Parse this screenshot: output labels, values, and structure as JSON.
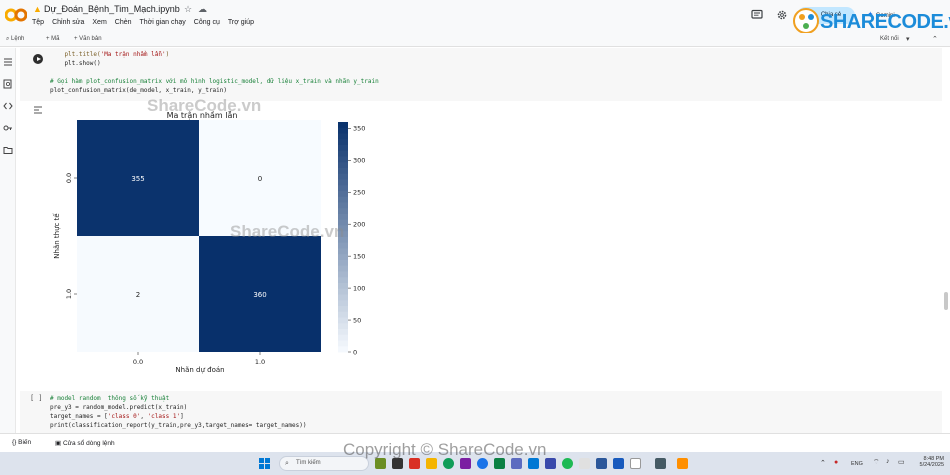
{
  "header": {
    "notebook_title": "Dự_Đoán_Bệnh_Tim_Mạch.ipynb",
    "menu": [
      "Tệp",
      "Chỉnh sửa",
      "Xem",
      "Chèn",
      "Thời gian chạy",
      "Công cụ",
      "Trợ giúp"
    ],
    "share_label": "Chia sẻ",
    "gemini_label": "Gemini"
  },
  "toolbar": {
    "commands_label": "Lệnh",
    "add_code_label": "+ Mã",
    "add_text_label": "+ Văn bản",
    "connect_label": "Kết nối"
  },
  "cell1": {
    "lines": [
      "    plt.title('Ma trận nhầm lẫn')",
      "    plt.show()",
      "",
      "# Gọi hàm plot_confusion_matrix với mô hình logistic_model, dữ liệu x_train và nhãn y_train",
      "plot_confusion_matrix(de_model, x_train, y_train)"
    ]
  },
  "chart_data": {
    "type": "heatmap",
    "title": "Ma trận nhầm lẫn",
    "xlabel": "Nhãn dự đoán",
    "ylabel": "Nhãn thực tế",
    "x_categories": [
      "0.0",
      "1.0"
    ],
    "y_categories": [
      "0.0",
      "1.0"
    ],
    "values": [
      [
        355,
        0
      ],
      [
        2,
        360
      ]
    ],
    "colorbar_ticks": [
      0,
      50,
      100,
      150,
      200,
      250,
      300,
      350
    ],
    "colormap": "Blues",
    "vmin": 0,
    "vmax": 360
  },
  "cell2": {
    "run_label": "[ ]",
    "lines": [
      "# model random  thông số kỹ thuật",
      "pre_y3 = random_model.predict(x_train)",
      "target_names = ['class 0', 'class 1']",
      "print(classification_report(y_train,pre_y3,target_names= target_names))"
    ]
  },
  "statusbar": {
    "variables_label": "Biến",
    "terminal_label": "Cửa sổ dòng lệnh"
  },
  "taskbar": {
    "search_placeholder": "Tìm kiếm",
    "lang": "ENG",
    "time": "8:48 PM",
    "date": "5/24/2025"
  },
  "watermarks": {
    "logo_text": "SHARECODE.vn",
    "center_text_1": "ShareCode.vn",
    "center_text_2": "ShareCode.vn",
    "copyright": "Copyright © ShareCode.vn"
  },
  "colors": {
    "header_bg": "#f8f9fa",
    "share_bg": "#c2e7ff",
    "cell_bg": "#f7f7f7",
    "heat_dark": "#08306b",
    "heat_light": "#f7fbff",
    "taskbar_bg": "#dde3ed"
  }
}
